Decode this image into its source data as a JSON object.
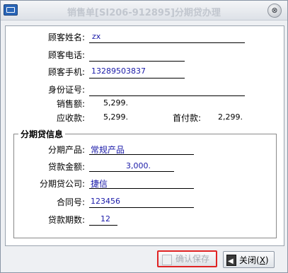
{
  "window": {
    "title": "销售单[SI206-912895]分期贷办理",
    "close_symbol": "⊗"
  },
  "customer": {
    "name_label": "顾客姓名:",
    "name_value": "zx",
    "phone_label": "顾客电话:",
    "phone_value": "",
    "mobile_label": "顾客手机:",
    "mobile_value": "13289503837",
    "id_label": "身份证号:",
    "id_value": "",
    "sales_label": "销售额:",
    "sales_value": "5,299.",
    "receivable_label": "应收款:",
    "receivable_value": "5,299.",
    "down_payment_label": "首付款:",
    "down_payment_value": "2,299."
  },
  "loan": {
    "group_title": "分期贷信息",
    "product_label": "分期产品:",
    "product_value": "常规产品",
    "amount_label": "贷款金额:",
    "amount_value": "3,000.",
    "company_label": "分期贷公司:",
    "company_value": "捷信",
    "contract_label": "合同号:",
    "contract_value": "123456",
    "periods_label": "贷款期数:",
    "periods_value": "12"
  },
  "buttons": {
    "save_label": "确认保存",
    "close_label": "关闭(",
    "close_hotkey": "X",
    "close_suffix": ")"
  }
}
